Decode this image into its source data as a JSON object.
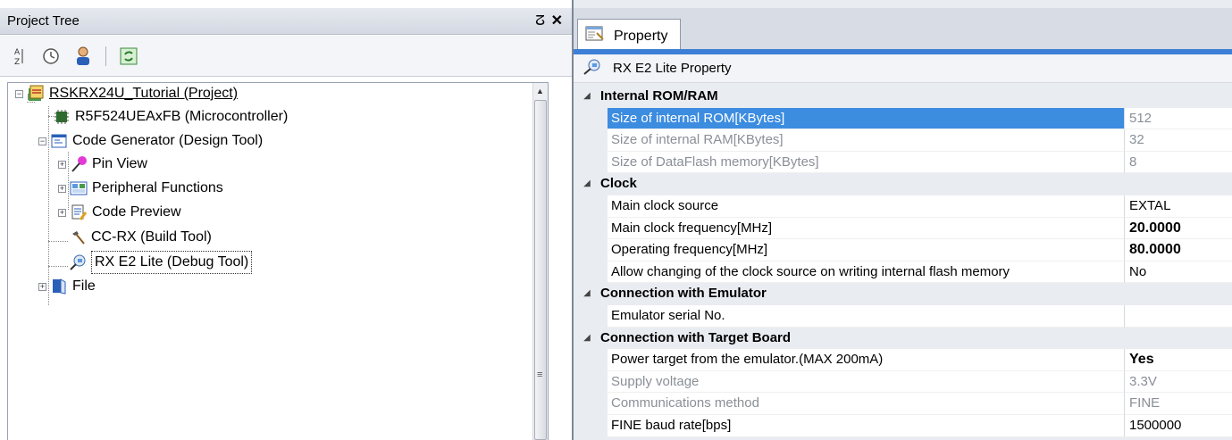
{
  "project_tree": {
    "title": "Project Tree",
    "pin_glyph": "ⵒ",
    "close_glyph": "✕",
    "nodes": [
      {
        "label": "RSKRX24U_Tutorial (Project)",
        "icon": "project-icon"
      },
      {
        "label": "R5F524UEAxFB (Microcontroller)",
        "icon": "chip-icon"
      },
      {
        "label": "Code Generator (Design Tool)",
        "icon": "code-generator-icon"
      },
      {
        "label": "Pin View",
        "icon": "pin-icon"
      },
      {
        "label": "Peripheral Functions",
        "icon": "peripheral-icon"
      },
      {
        "label": "Code Preview",
        "icon": "code-preview-icon"
      },
      {
        "label": "CC-RX (Build Tool)",
        "icon": "hammer-icon"
      },
      {
        "label": "RX E2 Lite (Debug Tool)",
        "icon": "debug-tool-icon"
      },
      {
        "label": "File",
        "icon": "file-icon"
      }
    ]
  },
  "property_panel": {
    "tab_label": "Property",
    "title": "RX E2 Lite Property",
    "categories": [
      {
        "name": "Internal ROM/RAM",
        "rows": [
          {
            "name": "Size of internal ROM[KBytes]",
            "value": "512"
          },
          {
            "name": "Size of internal RAM[KBytes]",
            "value": "32"
          },
          {
            "name": "Size of DataFlash memory[KBytes]",
            "value": "8"
          }
        ]
      },
      {
        "name": "Clock",
        "rows": [
          {
            "name": "Main clock source",
            "value": "EXTAL"
          },
          {
            "name": "Main clock frequency[MHz]",
            "value": "20.0000"
          },
          {
            "name": "Operating frequency[MHz]",
            "value": "80.0000"
          },
          {
            "name": "Allow changing of the clock source on writing internal flash memory",
            "value": "No"
          }
        ]
      },
      {
        "name": "Connection with Emulator",
        "rows": [
          {
            "name": "Emulator serial No.",
            "value": ""
          }
        ]
      },
      {
        "name": "Connection with Target Board",
        "rows": [
          {
            "name": "Power target from the emulator.(MAX 200mA)",
            "value": "Yes"
          },
          {
            "name": "Supply voltage",
            "value": "3.3V"
          },
          {
            "name": "Communications method",
            "value": "FINE"
          },
          {
            "name": "FINE baud rate[bps]",
            "value": "1500000"
          }
        ]
      }
    ]
  },
  "colors": {
    "selection": "#3c8ce0",
    "accent_bar": "#3d7fd6",
    "disabled_text": "#8a8f97"
  }
}
